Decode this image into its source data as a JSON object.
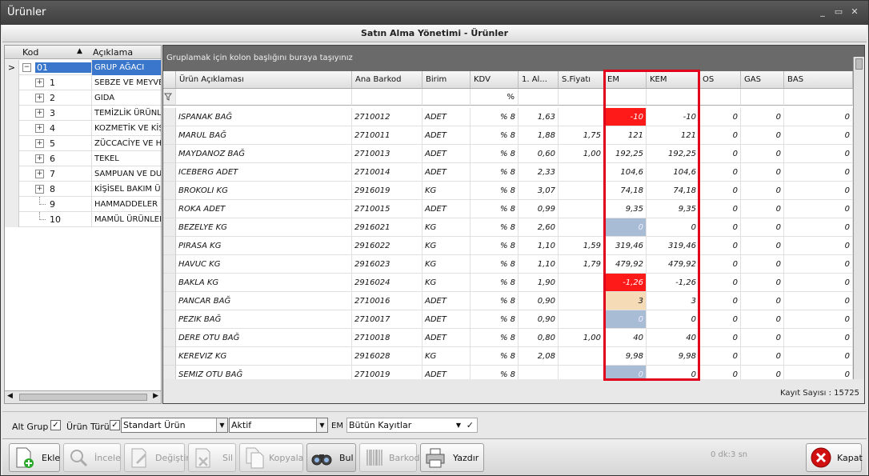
{
  "window": {
    "title": "Ürünler",
    "minimize": "_",
    "restore": "▭",
    "close": "✕"
  },
  "header": {
    "title": "Satın Alma Yönetimi - Ürünler"
  },
  "tree": {
    "col_kod": "Kod",
    "col_desc": "Açıklama",
    "sort_glyph": "▲",
    "rows": [
      {
        "kod": "01",
        "desc": "GRUP AĞACI",
        "expander": "−",
        "level": 0,
        "selected": true
      },
      {
        "kod": "1",
        "desc": "SEBZE VE MEYVEL",
        "expander": "+",
        "level": 1
      },
      {
        "kod": "2",
        "desc": "GIDA",
        "expander": "+",
        "level": 1
      },
      {
        "kod": "3",
        "desc": "TEMİZLİK ÜRÜNLE",
        "expander": "+",
        "level": 1
      },
      {
        "kod": "4",
        "desc": "KOZMETİK VE KİŞ",
        "expander": "+",
        "level": 1
      },
      {
        "kod": "5",
        "desc": "ZÜCCACİYE VE Hİ",
        "expander": "+",
        "level": 1
      },
      {
        "kod": "6",
        "desc": "TEKEL",
        "expander": "+",
        "level": 1
      },
      {
        "kod": "7",
        "desc": "SAMPUAN VE DUS",
        "expander": "+",
        "level": 1
      },
      {
        "kod": "8",
        "desc": "KİŞİSEL BAKIM Ü.",
        "expander": "+",
        "level": 1
      },
      {
        "kod": "9",
        "desc": "HAMMADDELER",
        "expander": "",
        "level": 1
      },
      {
        "kod": "10",
        "desc": "MAMÜL ÜRÜNLER",
        "expander": "",
        "level": 1
      }
    ],
    "row_indicator": ">"
  },
  "grid": {
    "grouping_hint": "Gruplamak için kolon başlığını buraya taşıyınız",
    "columns": [
      "Ürün Açıklaması",
      "Ana Barkod",
      "Birim",
      "KDV",
      "1. Al...",
      "S.Fiyatı",
      "EM",
      "KEM",
      "OS",
      "GAS",
      "BAS"
    ],
    "filter_kdv": "%",
    "filter_icon": "funnel-icon",
    "rows": [
      [
        "ISPANAK BAĞ",
        "2710012",
        "ADET",
        "% 8",
        "1,63",
        "",
        "-10",
        "-10",
        "0",
        "0",
        "0"
      ],
      [
        "MARUL BAĞ",
        "2710011",
        "ADET",
        "% 8",
        "1,88",
        "1,75",
        "121",
        "121",
        "0",
        "0",
        "0"
      ],
      [
        "MAYDANOZ BAĞ",
        "2710013",
        "ADET",
        "% 8",
        "0,60",
        "1,00",
        "192,25",
        "192,25",
        "0",
        "0",
        "0"
      ],
      [
        "ICEBERG ADET",
        "2710014",
        "ADET",
        "% 8",
        "2,33",
        "",
        "104,6",
        "104,6",
        "0",
        "0",
        "0"
      ],
      [
        "BROKOLI KG",
        "2916019",
        "KG",
        "% 8",
        "3,07",
        "",
        "74,18",
        "74,18",
        "0",
        "0",
        "0"
      ],
      [
        "ROKA ADET",
        "2710015",
        "ADET",
        "% 8",
        "0,99",
        "",
        "9,35",
        "9,35",
        "0",
        "0",
        "0"
      ],
      [
        "BEZELYE  KG",
        "2916021",
        "KG",
        "% 8",
        "2,60",
        "",
        "0",
        "0",
        "0",
        "0",
        "0"
      ],
      [
        "PIRASA  KG",
        "2916022",
        "KG",
        "% 8",
        "1,10",
        "1,59",
        "319,46",
        "319,46",
        "0",
        "0",
        "0"
      ],
      [
        "HAVUC KG",
        "2916023",
        "KG",
        "% 8",
        "1,10",
        "1,79",
        "479,92",
        "479,92",
        "0",
        "0",
        "0"
      ],
      [
        "BAKLA  KG",
        "2916024",
        "KG",
        "% 8",
        "1,90",
        "",
        "-1,26",
        "-1,26",
        "0",
        "0",
        "0"
      ],
      [
        "PANCAR BAĞ",
        "2710016",
        "ADET",
        "% 8",
        "0,90",
        "",
        "3",
        "3",
        "0",
        "0",
        "0"
      ],
      [
        "PEZIK BAĞ",
        "2710017",
        "ADET",
        "% 8",
        "0,90",
        "",
        "0",
        "0",
        "0",
        "0",
        "0"
      ],
      [
        "DERE OTU BAĞ",
        "2710018",
        "ADET",
        "% 8",
        "0,80",
        "1,00",
        "40",
        "40",
        "0",
        "0",
        "0"
      ],
      [
        "KEREVIZ  KG",
        "2916028",
        "KG",
        "% 8",
        "2,08",
        "",
        "9,98",
        "9,98",
        "0",
        "0",
        "0"
      ],
      [
        "SEMIZ OTU BAĞ",
        "2710019",
        "ADET",
        "% 8",
        "",
        "",
        "0",
        "0",
        "0",
        "0",
        "0"
      ]
    ],
    "em_status": [
      "negative",
      "",
      "",
      "",
      "",
      "",
      "zero",
      "",
      "",
      "negative",
      "low",
      "zero",
      "",
      "",
      "zero"
    ],
    "record_count": "Kayıt Sayısı : 15725"
  },
  "colors": {
    "negative": "#ff1a1a",
    "zero": "#a9bcd6",
    "low": "#f6dcb6",
    "highlight": "#e0001b",
    "selection": "#3a77cc"
  },
  "filters": {
    "alt_grup_label": "Alt Grup",
    "alt_grup_checked": "✓",
    "urun_turu_label": "Ürün Türü",
    "urun_turu_checked": "✓",
    "urun_turu_value": "Standart Ürün",
    "status_value": "Aktif",
    "em_label": "EM",
    "records_value": "Bütün Kayıtlar",
    "records_confirm": "✓"
  },
  "toolbar": {
    "ekle": "Ekle",
    "incele": "İncele",
    "degistir": "Değiştir",
    "sil": "Sil",
    "kopyala": "Kopyala",
    "bul": "Bul",
    "barkod": "Barkod",
    "yazdir": "Yazdır",
    "timer": "0 dk:3 sn",
    "kapat": "Kapat"
  }
}
